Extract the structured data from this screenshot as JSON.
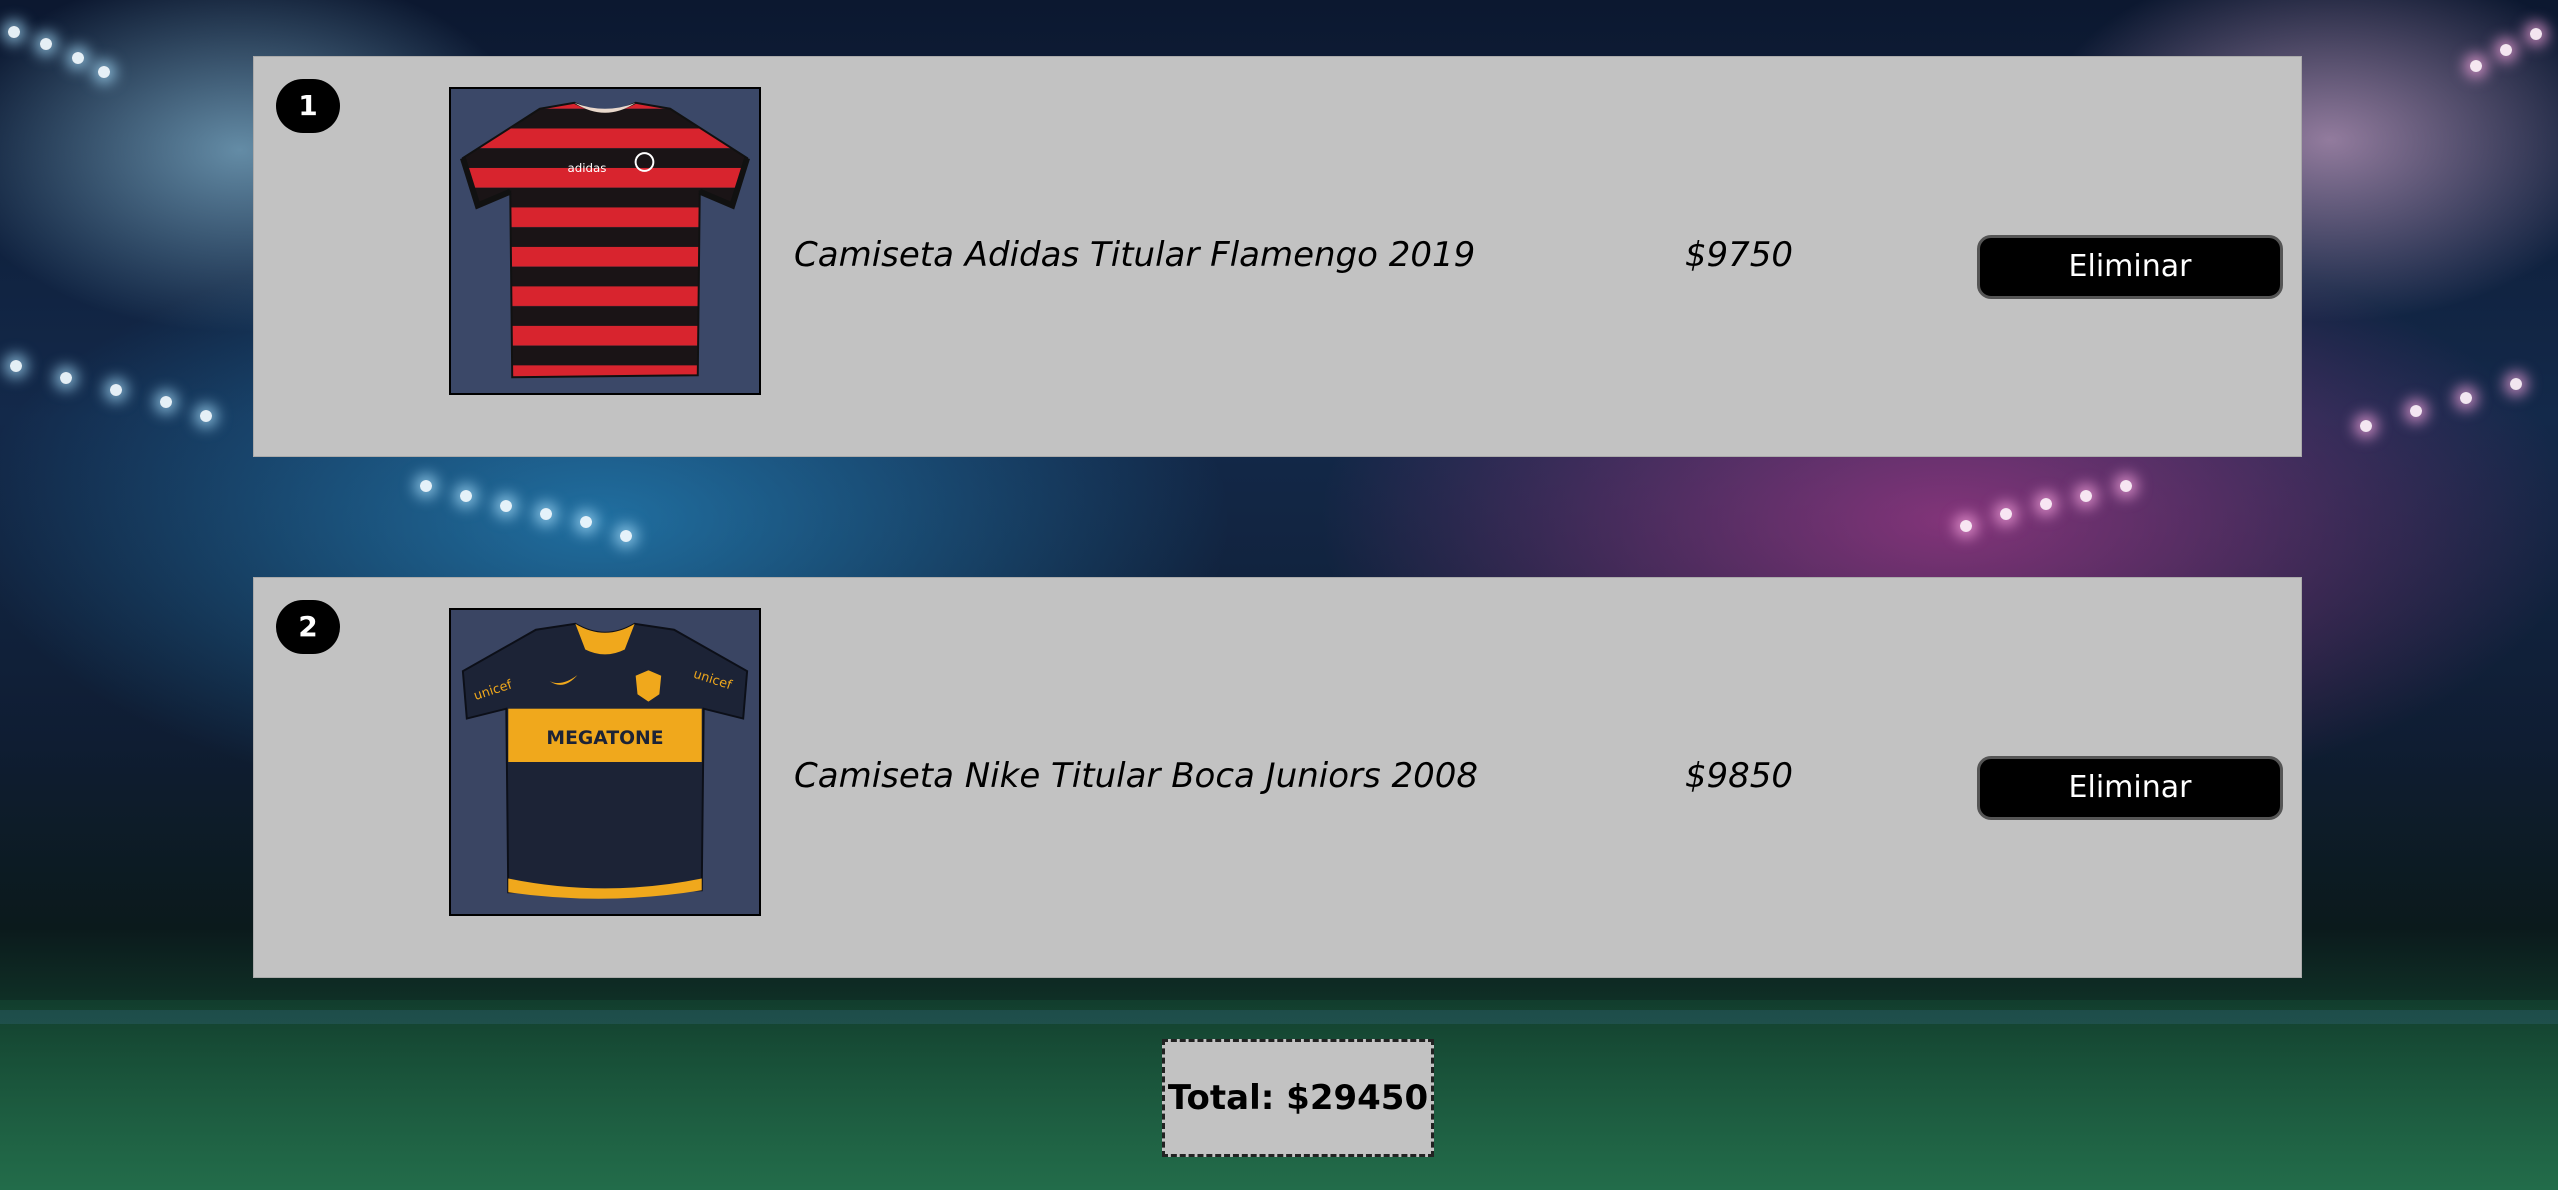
{
  "cart": {
    "items": [
      {
        "index": "1",
        "name": "Camiseta Adidas Titular Flamengo 2019",
        "price": "$9750",
        "remove_label": "Eliminar",
        "image_icon": "flamengo-jersey-image"
      },
      {
        "index": "2",
        "name": "Camiseta Nike Titular Boca Juniors 2008",
        "price": "$9850",
        "remove_label": "Eliminar",
        "image_icon": "boca-jersey-image",
        "jersey_text": "MEGATONE",
        "sleeve_text": "unicef"
      }
    ],
    "total": "Total: $29450"
  },
  "colors": {
    "panel": "#c2c2c2",
    "button": "#000000",
    "flamengo_red": "#d8242e",
    "boca_navy": "#1c2336",
    "boca_gold": "#f0a81c"
  }
}
